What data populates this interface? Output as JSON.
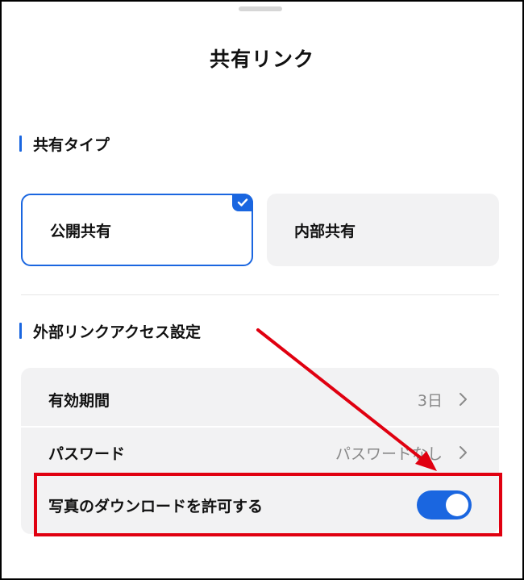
{
  "sheet": {
    "title": "共有リンク"
  },
  "share_type": {
    "header": "共有タイプ",
    "options": [
      {
        "label": "公開共有",
        "selected": true
      },
      {
        "label": "内部共有",
        "selected": false
      }
    ]
  },
  "access_settings": {
    "header": "外部リンクアクセス設定",
    "rows": [
      {
        "label": "有効期間",
        "value": "3日"
      },
      {
        "label": "パスワード",
        "value": "パスワードなし"
      }
    ],
    "download_toggle": {
      "label": "写真のダウンロードを許可する",
      "on": true
    }
  },
  "colors": {
    "accent": "#1a66e0",
    "annotation": "#e00010",
    "card_bg": "#f2f2f3"
  },
  "icons": {
    "selected_check": "check-icon",
    "row_arrow": "chevron-right-icon"
  }
}
